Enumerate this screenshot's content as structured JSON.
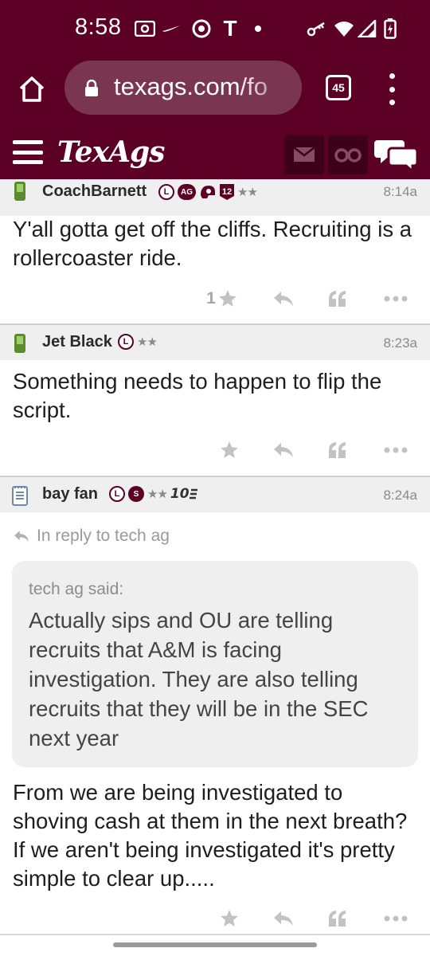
{
  "status_bar": {
    "time": "8:58",
    "icons": [
      "cast-icon",
      "swoosh-icon",
      "chrome-icon",
      "t-mobile-icon",
      "dot-icon",
      "key-icon",
      "wifi-icon",
      "signal-icon",
      "battery-charging-icon"
    ]
  },
  "browser": {
    "url": "texags.com/fo",
    "tab_count": "45"
  },
  "site": {
    "logo": "TexAgs",
    "brand_color": "#5d0025"
  },
  "posts": [
    {
      "username": "CoachBarnett",
      "badges": [
        "L",
        "AG"
      ],
      "badge_number": "12",
      "stars": "★★",
      "time": "8:14a",
      "body": "Y'all gotta get off the cliffs. Recruiting is a rollercoaster ride.",
      "star_count": "1"
    },
    {
      "username": "Jet Black",
      "badges": [
        "L"
      ],
      "stars": "★★",
      "time": "8:23a",
      "body": "Something needs to happen to flip the script."
    },
    {
      "username": "bay fan",
      "badges": [
        "L",
        "S"
      ],
      "stars": "★★",
      "tenure": "10",
      "time": "8:24a",
      "reply_to": "In reply to tech ag",
      "quote_author": "tech ag said:",
      "quote_text": "Actually sips and OU are telling recruits that A&M is facing investigation. They are also telling recruits that they will be in the SEC next year",
      "body": "From we are being investigated to shoving cash at them in the next breath? If we aren't being investigated it's pretty simple to clear up....."
    }
  ]
}
